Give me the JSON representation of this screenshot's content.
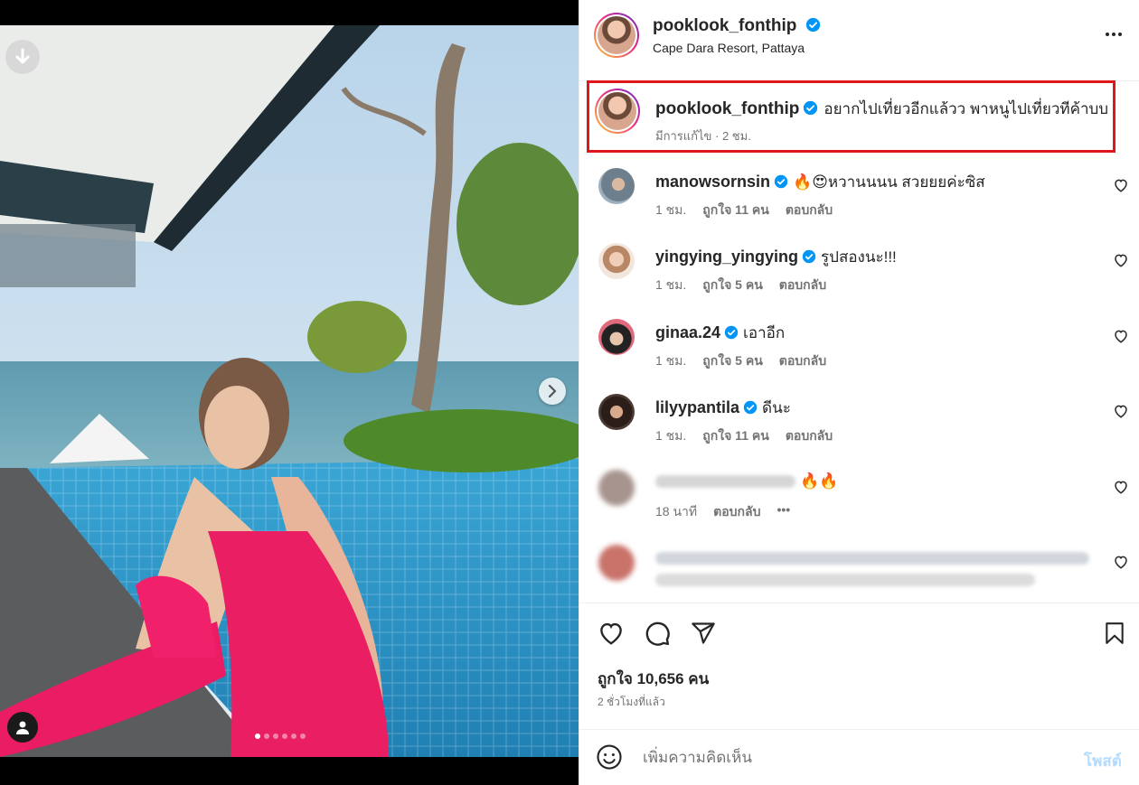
{
  "post": {
    "username": "pooklook_fonthip",
    "location": "Cape Dara Resort, Pattaya",
    "caption": "อยากไปเที่ยวอีกแล้วว พาหนูไปเที่ยวทีค้าบบ",
    "caption_meta": "มีการแก้ไข · 2 ชม.",
    "likes_text": "ถูกใจ 10,656 คน",
    "time_text": "2 ชั่วโมงที่แล้ว",
    "photo_count": 6,
    "active_photo": 1
  },
  "comments": [
    {
      "username": "manowsornsin",
      "text": "🔥😍หวานนนน สวยยยค่ะซิส",
      "time": "1 ชม.",
      "likes": "ถูกใจ 11 คน",
      "reply": "ตอบกลับ"
    },
    {
      "username": "yingying_yingying",
      "text": "รูปสองนะ!!!",
      "time": "1 ชม.",
      "likes": "ถูกใจ 5 คน",
      "reply": "ตอบกลับ"
    },
    {
      "username": "ginaa.24",
      "text": "เอาอีก",
      "time": "1 ชม.",
      "likes": "ถูกใจ 5 คน",
      "reply": "ตอบกลับ"
    },
    {
      "username": "lilyypantila",
      "text": "ดีนะ",
      "time": "1 ชม.",
      "likes": "ถูกใจ 11 คน",
      "reply": "ตอบกลับ"
    },
    {
      "username": "",
      "text": "🔥🔥",
      "time": "18 นาที",
      "likes": "",
      "reply": "ตอบกลับ",
      "more": "•••"
    }
  ],
  "composer": {
    "placeholder": "เพิ่มความคิดเห็น",
    "post_label": "โพสต์"
  },
  "colors": {
    "verified": "#0095f6",
    "highlight_border": "#e0161d",
    "post_button_disabled": "#b3dbff"
  }
}
